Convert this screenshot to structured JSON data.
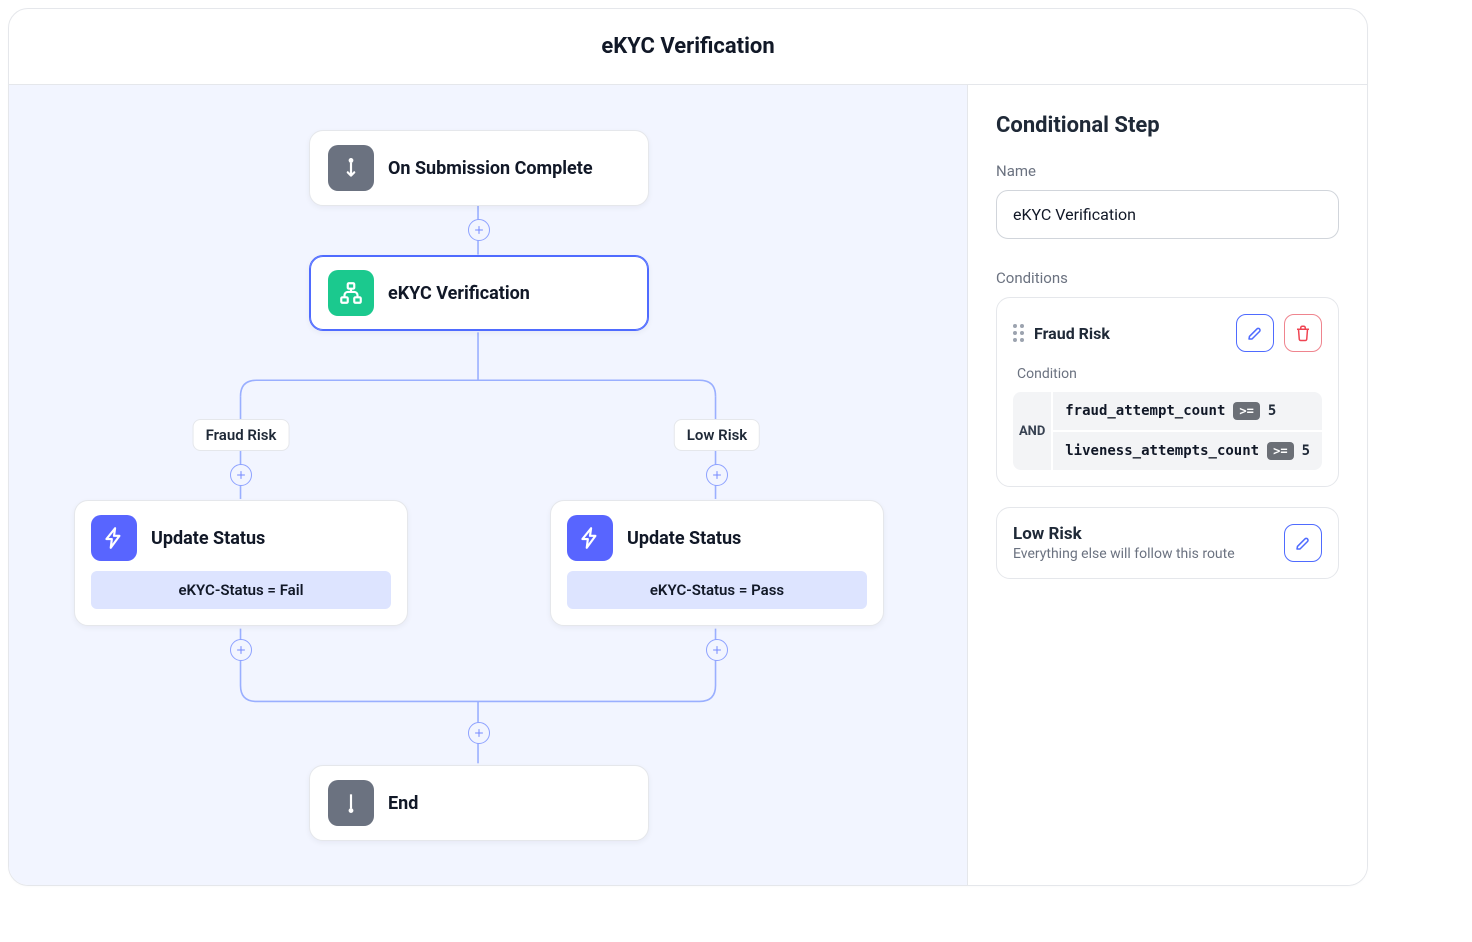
{
  "header": {
    "title": "eKYC Verification"
  },
  "canvas": {
    "start_label": "On Submission Complete",
    "selected_label": "eKYC Verification",
    "branches": {
      "left": {
        "label": "Fraud Risk",
        "action_title": "Update Status",
        "status_text": "eKYC-Status = Fail"
      },
      "right": {
        "label": "Low Risk",
        "action_title": "Update Status",
        "status_text": "eKYC-Status = Pass"
      }
    },
    "end_label": "End"
  },
  "side": {
    "title": "Conditional Step",
    "name_label": "Name",
    "name_value": "eKYC Verification",
    "conditions_label": "Conditions",
    "condition": {
      "name": "Fraud Risk",
      "sub_label": "Condition",
      "logic_op": "AND",
      "rows": [
        {
          "field": "fraud_attempt_count",
          "op": ">=",
          "value": "5"
        },
        {
          "field": "liveness_attempts_count",
          "op": ">=",
          "value": "5"
        }
      ]
    },
    "else_route": {
      "title": "Low Risk",
      "sub": "Everything else will follow this route"
    }
  }
}
